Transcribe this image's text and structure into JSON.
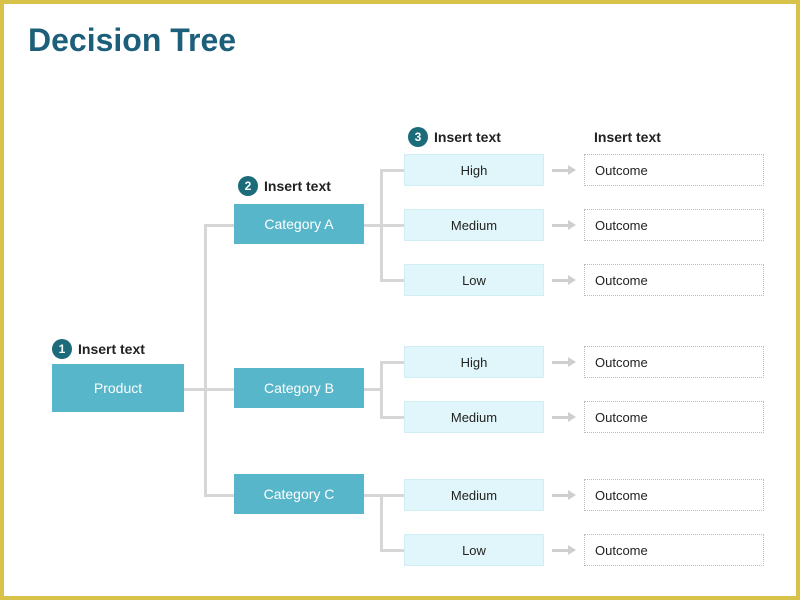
{
  "title": "Decision Tree",
  "levels": [
    {
      "num": "1",
      "label": "Insert text"
    },
    {
      "num": "2",
      "label": "Insert text"
    },
    {
      "num": "3",
      "label": "Insert text"
    }
  ],
  "outcome_header": "Insert text",
  "root": {
    "label": "Product"
  },
  "categories": [
    {
      "label": "Category A"
    },
    {
      "label": "Category B"
    },
    {
      "label": "Category C"
    }
  ],
  "leaves": [
    {
      "cat": 0,
      "label": "High",
      "outcome": "Outcome"
    },
    {
      "cat": 0,
      "label": "Medium",
      "outcome": "Outcome"
    },
    {
      "cat": 0,
      "label": "Low",
      "outcome": "Outcome"
    },
    {
      "cat": 1,
      "label": "High",
      "outcome": "Outcome"
    },
    {
      "cat": 1,
      "label": "Medium",
      "outcome": "Outcome"
    },
    {
      "cat": 2,
      "label": "Medium",
      "outcome": "Outcome"
    },
    {
      "cat": 2,
      "label": "Low",
      "outcome": "Outcome"
    }
  ],
  "colors": {
    "border": "#d9c24a",
    "title": "#1b5f7a",
    "node": "#57b6c9",
    "leaf": "#e1f6fa",
    "badge": "#1b6b7a"
  }
}
